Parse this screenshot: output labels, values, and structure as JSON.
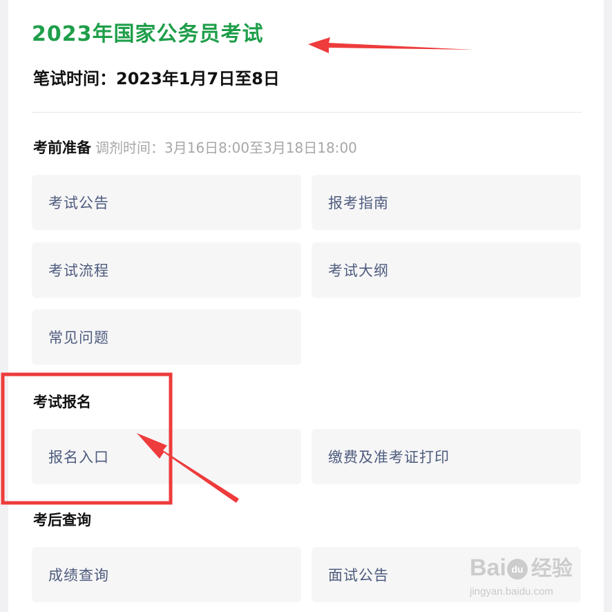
{
  "header": {
    "title": "2023年国家公务员考试",
    "written_exam_date": "笔试时间：2023年1月7日至8日"
  },
  "sections": [
    {
      "heading": "考前准备",
      "note": "调剂时间：3月16日8:00至3月18日18:00",
      "items": [
        "考试公告",
        "报考指南",
        "考试流程",
        "考试大纲",
        "常见问题"
      ]
    },
    {
      "heading": "考试报名",
      "items": [
        "报名入口",
        "缴费及准考证打印"
      ]
    },
    {
      "heading": "考后查询",
      "items": [
        "成绩查询",
        "面试公告"
      ]
    }
  ],
  "watermark": {
    "logo_prefix": "Bai",
    "logo_paw": "du",
    "logo_suffix": "经验",
    "url": "jingyan.baidu.com"
  },
  "colors": {
    "title_green": "#1f9e4a",
    "tile_bg": "#f6f6f7",
    "tile_text": "#4e5b7d",
    "annotation_red": "#ee3b3b"
  }
}
